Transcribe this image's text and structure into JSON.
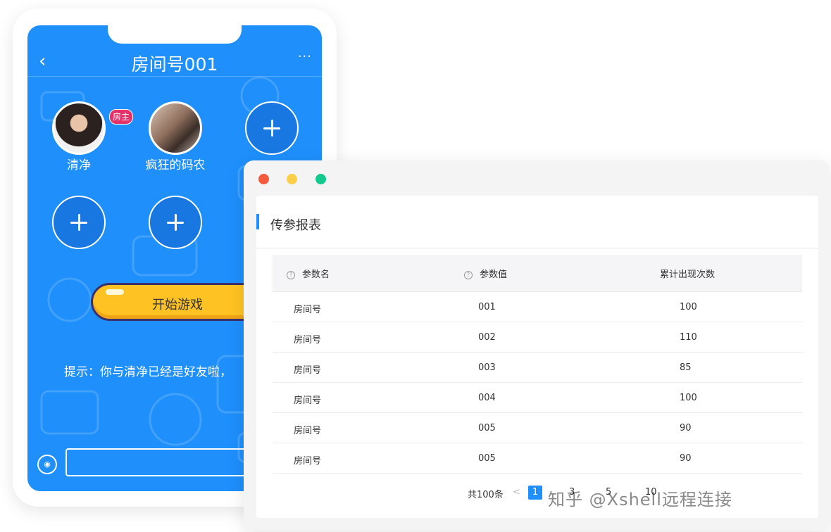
{
  "phone": {
    "title": "房间号001",
    "back_icon": "chevron-left-icon",
    "more_label": "···",
    "owner_badge": "房主",
    "seats": [
      {
        "name": "清净",
        "type": "user"
      },
      {
        "name": "疯狂的码农",
        "type": "user"
      },
      {
        "type": "empty"
      },
      {
        "type": "empty"
      },
      {
        "type": "empty"
      }
    ],
    "start_button": "开始游戏",
    "tip": "提示：你与清净已经是好友啦，",
    "input_placeholder": ""
  },
  "window": {
    "title": "传参报表",
    "traffic_lights": [
      "#f45a3c",
      "#fbcf4a",
      "#13c98d"
    ],
    "columns": [
      "参数名",
      "参数值",
      "累计出现次数"
    ],
    "rows": [
      [
        "房间号",
        "001",
        "100"
      ],
      [
        "房间号",
        "002",
        "110"
      ],
      [
        "房间号",
        "003",
        "85"
      ],
      [
        "房间号",
        "004",
        "100"
      ],
      [
        "房间号",
        "005",
        "90"
      ],
      [
        "房间号",
        "005",
        "90"
      ]
    ],
    "pagination": {
      "total": "共100条",
      "prev": "<",
      "current": "1",
      "pages": [
        "3",
        "5",
        "10"
      ]
    }
  },
  "watermark": "知乎 @Xshell远程连接"
}
